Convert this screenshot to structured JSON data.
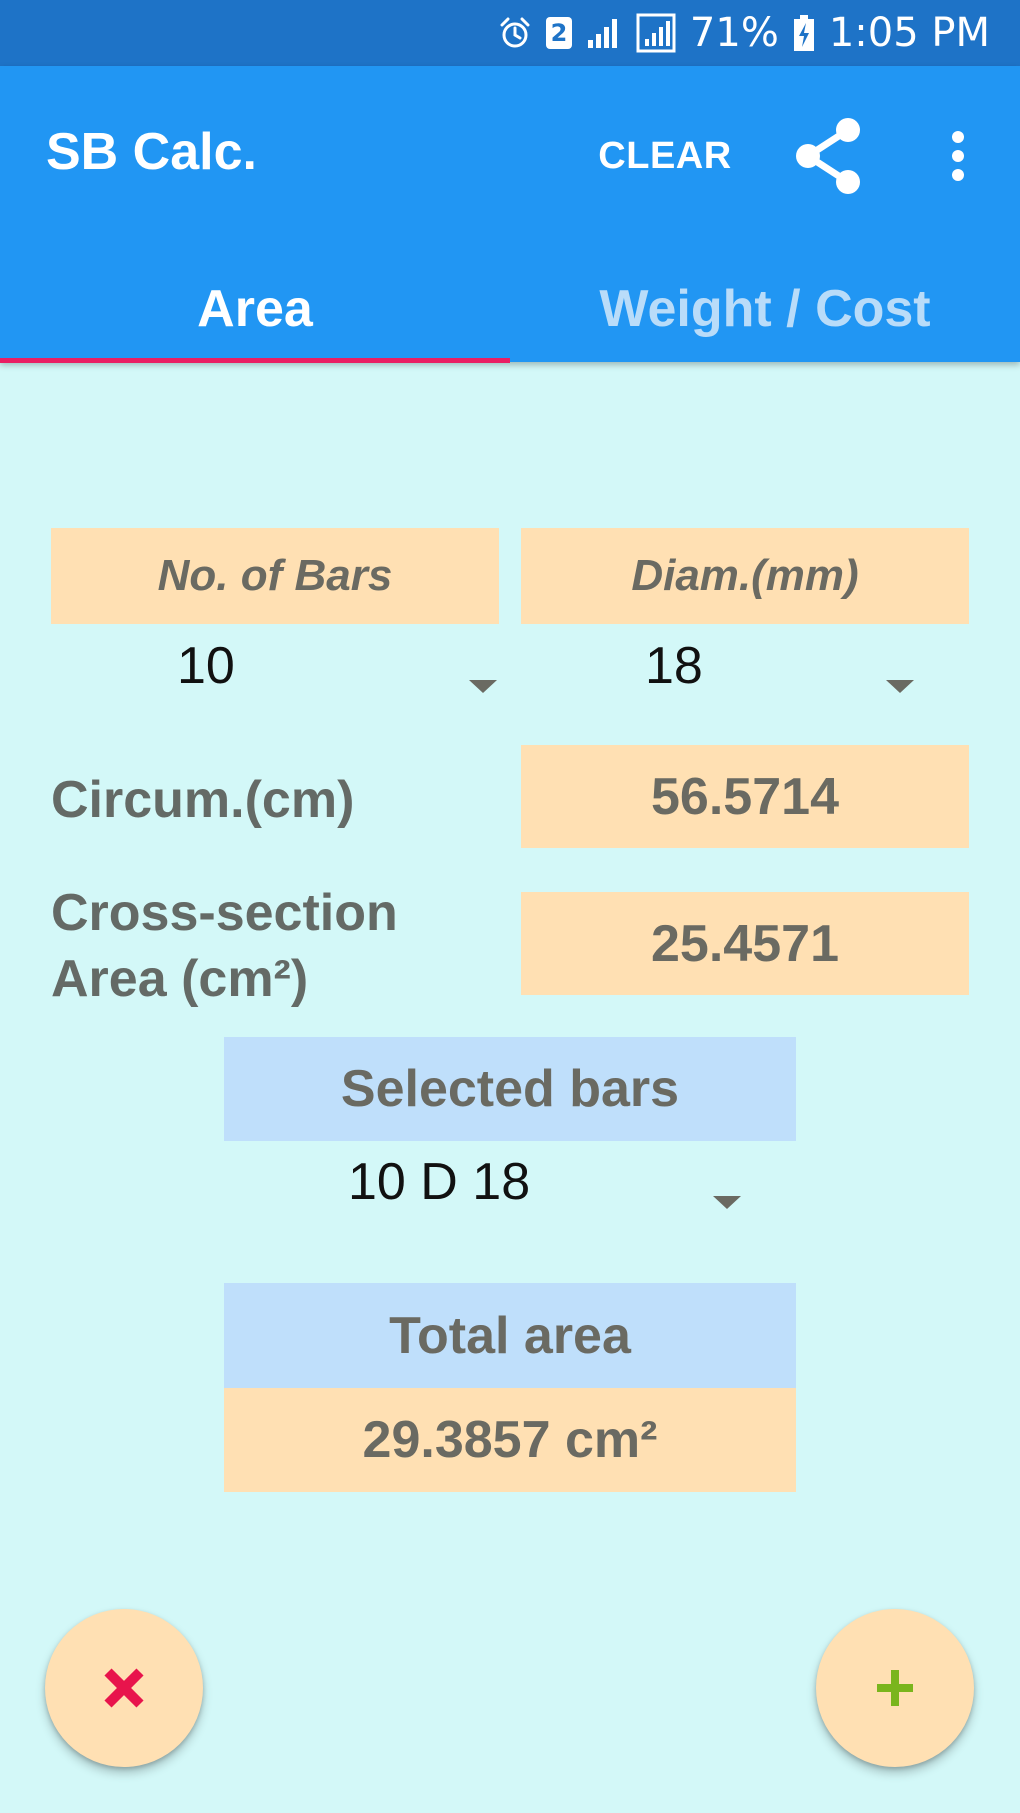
{
  "status_bar": {
    "sim_badge": "2",
    "battery_percent": "71%",
    "time": "1:05 PM",
    "icons": [
      "alarm-icon",
      "signal-icon",
      "signal-icon",
      "battery-charging-icon"
    ]
  },
  "app_bar": {
    "title": "SB Calc.",
    "clear_label": "CLEAR",
    "share_icon": "share-icon",
    "more_icon": "more-vert-icon"
  },
  "tabs": [
    {
      "label": "Area",
      "selected": true
    },
    {
      "label": "Weight / Cost",
      "selected": false
    }
  ],
  "form": {
    "bars_header": "No. of Bars",
    "diam_header": "Diam.(mm)",
    "bars_value": "10",
    "diam_value": "18",
    "circum_label": "Circum.(cm)",
    "circum_value": "56.5714",
    "cross_label_line1": "Cross-section",
    "cross_label_line2": "Area (cm²)",
    "cross_value": "25.4571",
    "selected_header": "Selected bars",
    "selected_value": "10 D 18",
    "total_header": "Total area",
    "total_value": "29.3857 cm²"
  },
  "fabs": {
    "remove_icon": "close-icon",
    "add_icon": "plus-icon"
  },
  "colors": {
    "status_bar": "#1e73c7",
    "app_bar": "#2196f3",
    "tab_indicator": "#e91e63",
    "background": "#d3f8f8",
    "peach": "#ffe0b3",
    "light_blue": "#bfdffb",
    "remove_red": "#e8144c",
    "add_green": "#7ab51d"
  }
}
